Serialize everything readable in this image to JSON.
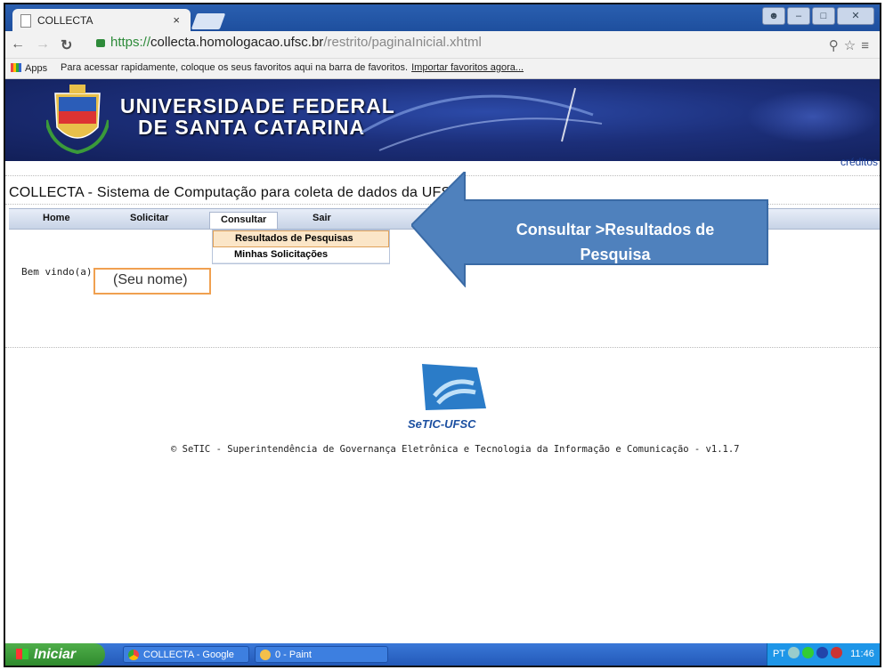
{
  "browser": {
    "tab_title": "COLLECTA",
    "tab_close": "×",
    "url_secure": "https://",
    "url_host": "collecta.homologacao.ufsc.br",
    "url_path": "/restrito/paginaInicial.xhtml",
    "bookmarks_apps": "Apps",
    "bookmarks_hint": "Para acessar rapidamente, coloque os seus favoritos aqui na barra de favoritos.",
    "bookmarks_import": "Importar favoritos agora..."
  },
  "banner": {
    "line1": "UNIVERSIDADE FEDERAL",
    "line2": "DE SANTA CATARINA"
  },
  "header": {
    "credits": "créditos",
    "system_title": "COLLECTA - Sistema de Computação para coleta de dados da UFSC."
  },
  "menu": {
    "home": "Home",
    "solicitar": "Solicitar",
    "consultar": "Consultar",
    "sair": "Sair",
    "dropdown": [
      "Resultados de Pesquisas",
      "Minhas Solicitações"
    ]
  },
  "main": {
    "welcome": "Bem vindo(a)",
    "name_placeholder": "(Seu nome)"
  },
  "callout": {
    "line1": "Consultar >Resultados de",
    "line2": "Pesquisa"
  },
  "footer": {
    "logo_text": "SeTIC-UFSC",
    "copyright": "© SeTIC - Superintendência de Governança Eletrônica e Tecnologia da Informação e Comunicação - v1.1.7"
  },
  "taskbar": {
    "start": "Iniciar",
    "items": [
      "COLLECTA - Google C...",
      "0 - Paint"
    ],
    "lang": "PT",
    "clock": "11:46"
  },
  "colors": {
    "accent": "#1b4fa0",
    "callout_fill": "#4f81bd",
    "highlight_border": "#f0a050"
  }
}
